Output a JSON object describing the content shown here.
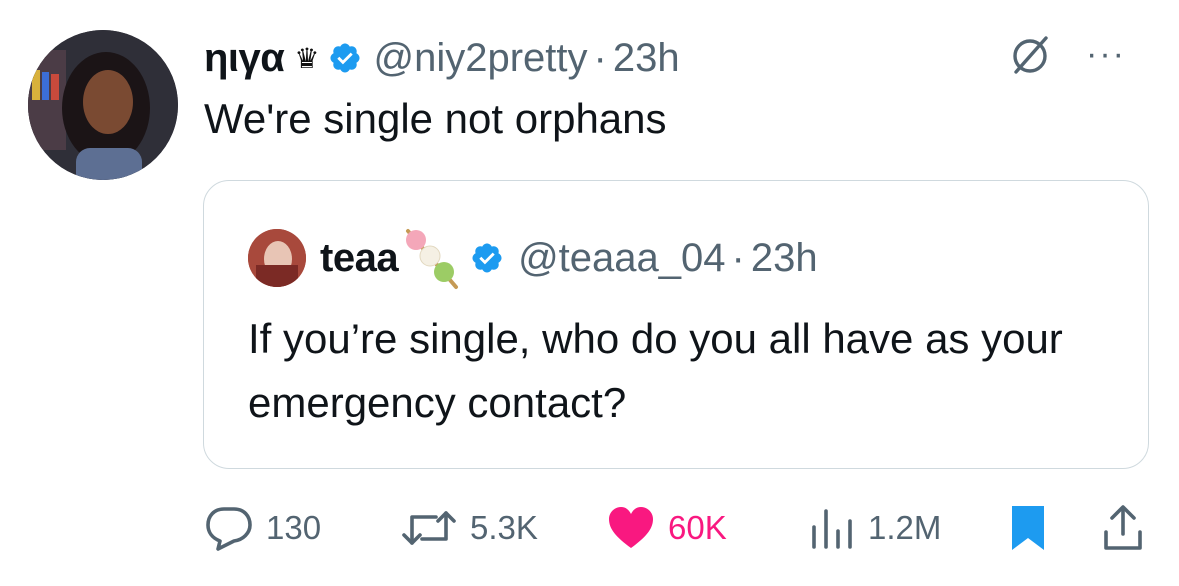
{
  "tweet": {
    "display_name": "ηιγα",
    "name_emoji": "♛",
    "handle": "@niy2pretty",
    "separator": "·",
    "time": "23h",
    "text": "We're single not orphans",
    "more_label": "···"
  },
  "quoted_tweet": {
    "display_name": "teaa",
    "handle": "@teaaa_04",
    "separator": "·",
    "time": "23h",
    "text": "If you’re single, who do you all have as your emergency contact?"
  },
  "actions": {
    "replies": "130",
    "reposts": "5.3K",
    "likes": "60K",
    "views": "1.2M"
  },
  "colors": {
    "verified": "#1d9bf0",
    "like": "#f91880",
    "bookmark": "#1d9bf0",
    "muted_text": "#536471",
    "border": "#cfd9de"
  },
  "icons": [
    "grok-icon",
    "more-icon",
    "reply-icon",
    "repost-icon",
    "heart-icon",
    "views-icon",
    "bookmark-icon",
    "share-icon",
    "verified-badge-icon"
  ]
}
